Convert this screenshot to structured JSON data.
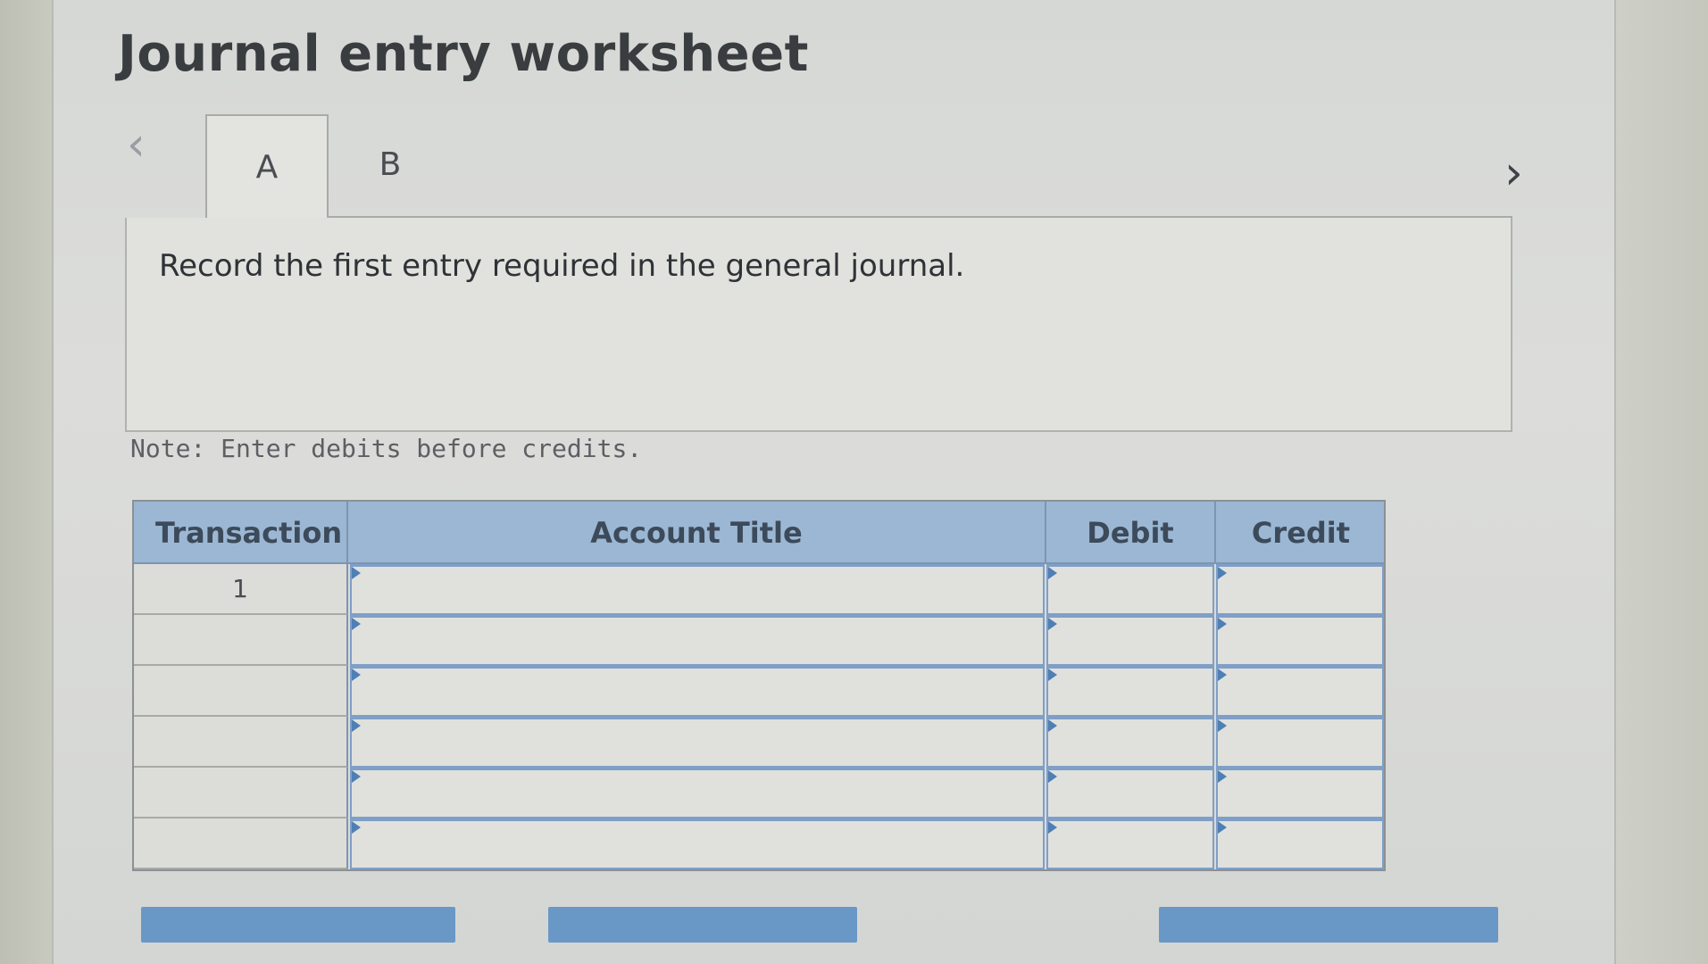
{
  "worksheet": {
    "title": "Journal entry worksheet",
    "tabs": [
      {
        "label": "A",
        "active": true
      },
      {
        "label": "B",
        "active": false
      }
    ],
    "prompt": "Record the first entry required in the general journal.",
    "note": "Note: Enter debits before credits."
  },
  "icons": {
    "prev": "chevron-left-icon",
    "next": "chevron-right-icon"
  },
  "table": {
    "headers": [
      "Transaction",
      "Account Title",
      "Debit",
      "Credit"
    ],
    "rows": [
      {
        "transaction": "1"
      },
      {
        "transaction": ""
      },
      {
        "transaction": ""
      },
      {
        "transaction": ""
      },
      {
        "transaction": ""
      },
      {
        "transaction": ""
      }
    ]
  },
  "colors": {
    "header_bg": "#9bb7d4",
    "button_bg": "#6a98c6",
    "input_border": "#7f9fc7"
  }
}
